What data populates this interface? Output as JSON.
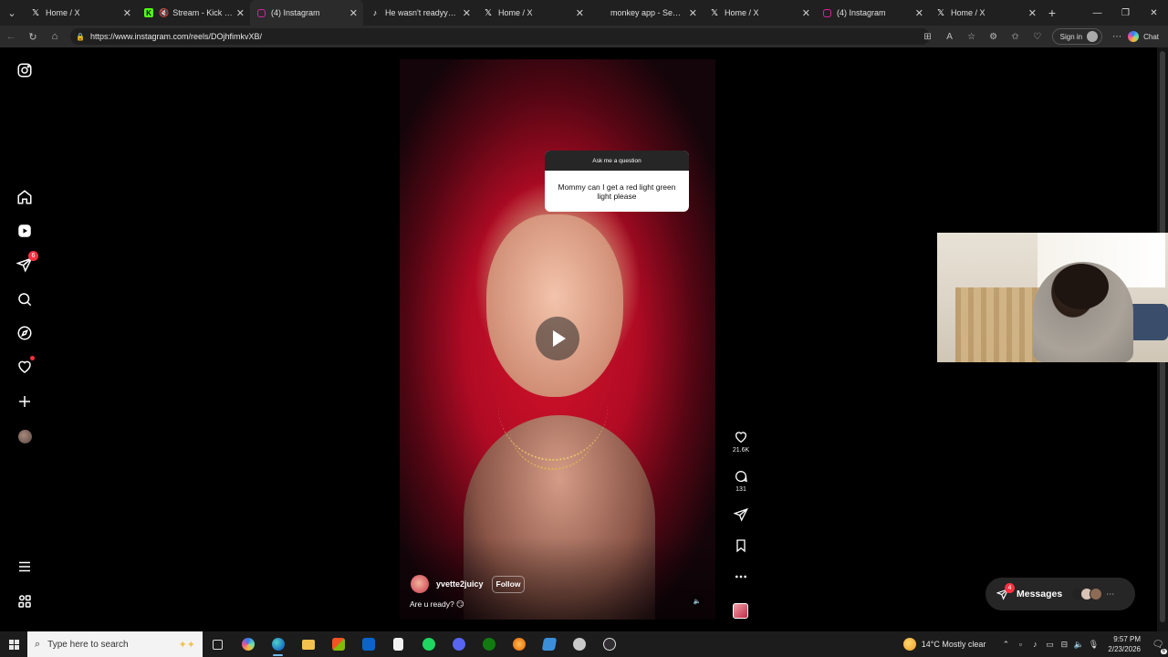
{
  "browser": {
    "tabs": [
      {
        "label": "Home / X",
        "favicon": "x-logo-icon",
        "active": false,
        "muted": false
      },
      {
        "label": "Stream - Kick Dashb",
        "favicon": "kick-logo-icon",
        "active": false,
        "muted": true
      },
      {
        "label": "(4) Instagram",
        "favicon": "instagram-logo-icon",
        "active": true,
        "muted": false
      },
      {
        "label": "He wasn't readyyyy.😂",
        "favicon": "tiktok-logo-icon",
        "active": false,
        "muted": false
      },
      {
        "label": "Home / X",
        "favicon": "x-logo-icon",
        "active": false,
        "muted": false
      },
      {
        "label": "monkey app - Search",
        "favicon": "search-logo-icon",
        "active": false,
        "muted": false
      },
      {
        "label": "Home / X",
        "favicon": "x-logo-icon",
        "active": false,
        "muted": false
      },
      {
        "label": "(4) Instagram",
        "favicon": "instagram-logo-icon",
        "active": false,
        "muted": false
      },
      {
        "label": "Home / X",
        "favicon": "x-logo-icon",
        "active": false,
        "muted": false
      }
    ],
    "url": "https://www.instagram.com/reels/DOjhfimkvXB/",
    "signin_label": "Sign in",
    "chat_label": "Chat"
  },
  "instagram": {
    "sidebar": {
      "notifications_badge": "6",
      "accent": "#ff3040"
    },
    "reel": {
      "sticker_header": "Ask me a question",
      "sticker_text": "Mommy can I get a red light green light please",
      "username": "yvette2juicy",
      "follow_label": "Follow",
      "caption": "Are u ready? 😏",
      "likes": "21.6K",
      "comments": "131"
    },
    "messages": {
      "label": "Messages",
      "badge": "4"
    }
  },
  "taskbar": {
    "search_placeholder": "Type here to search",
    "weather": "14°C  Mostly clear",
    "time": "9:57 PM",
    "date": "2/23/2026",
    "notification_count": "6"
  }
}
